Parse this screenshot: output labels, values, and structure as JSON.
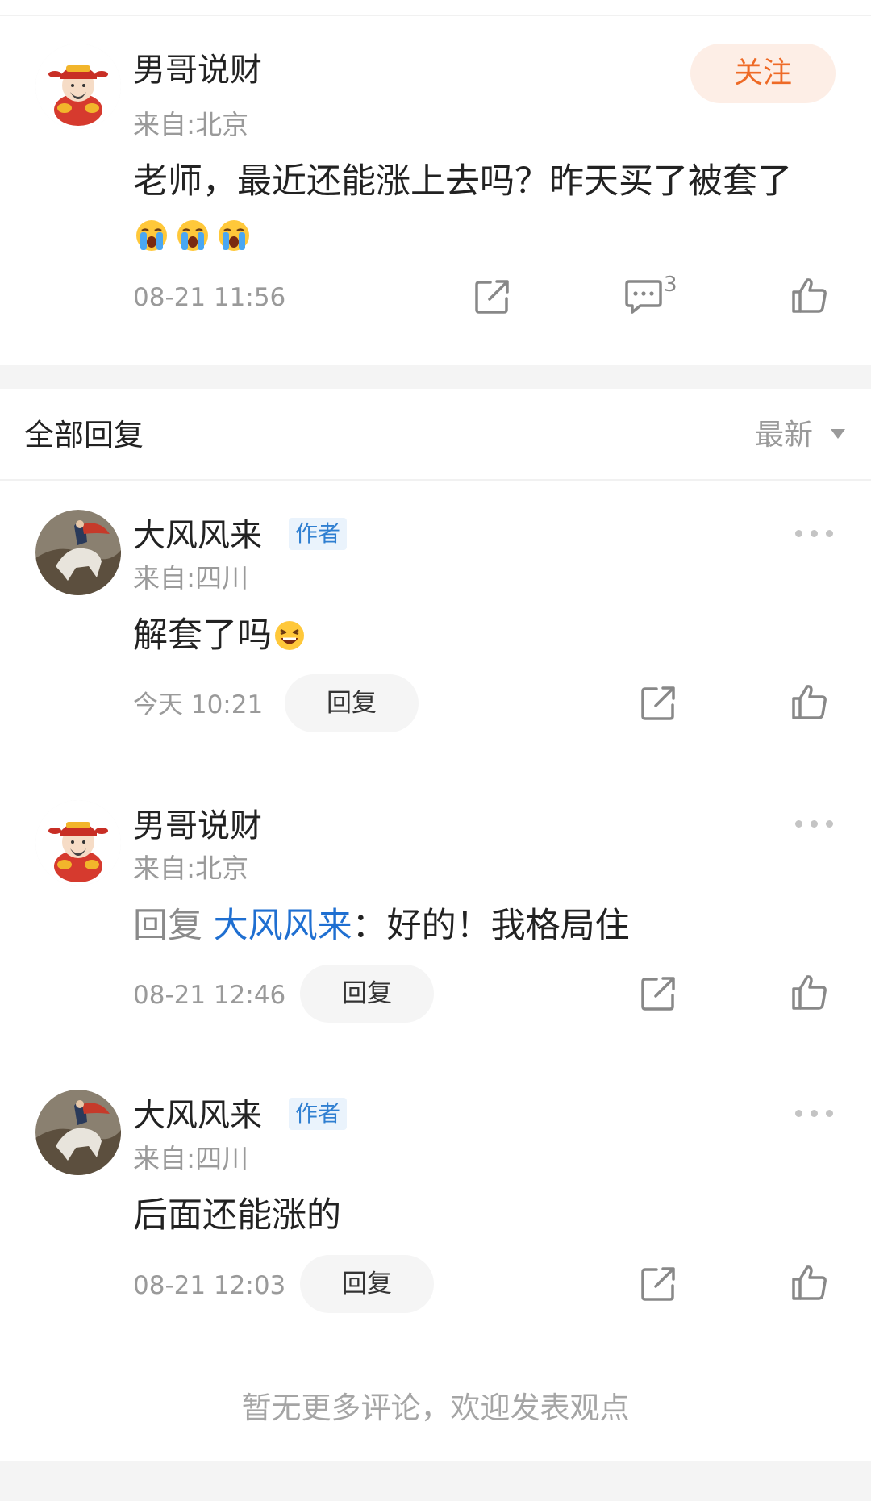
{
  "main_comment": {
    "author": "男哥说财",
    "location": "来自:北京",
    "text": "老师，最近还能涨上去吗？昨天买了被套了",
    "emojis": [
      "crying-emoji",
      "crying-emoji",
      "crying-emoji"
    ],
    "time": "08-21 11:56",
    "follow_label": "关注",
    "comment_count": "3"
  },
  "replies_header": {
    "title": "全部回复",
    "sort_label": "最新"
  },
  "replies": [
    {
      "author": "大风风来",
      "badge": "作者",
      "location": "来自:四川",
      "text": "解套了吗",
      "emoji": "laughing-emoji",
      "time": "今天 10:21",
      "reply_label": "回复"
    },
    {
      "author": "男哥说财",
      "location": "来自:北京",
      "reply_prefix": "回复",
      "reply_target": "大风风来",
      "text": "：好的！我格局住",
      "time": "08-21 12:46",
      "reply_label": "回复"
    },
    {
      "author": "大风风来",
      "badge": "作者",
      "location": "来自:四川",
      "text": "后面还能涨的",
      "time": "08-21 12:03",
      "reply_label": "回复"
    }
  ],
  "footer": {
    "no_more_text": "暂无更多评论，欢迎发表观点"
  },
  "colors": {
    "follow_text": "#ee6a26",
    "follow_bg": "#fdeee6",
    "author_badge_text": "#2f7fd1",
    "author_badge_bg": "#eaf3fc",
    "reply_target": "#1f6fd1"
  }
}
